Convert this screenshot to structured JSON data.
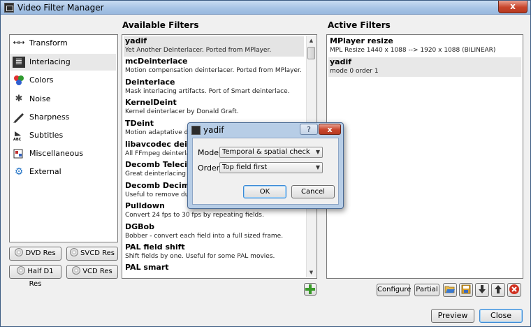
{
  "window": {
    "title": "Video Filter Manager",
    "close_label": "x"
  },
  "categories": {
    "heading": "",
    "items": [
      {
        "label": "Transform",
        "icon": "transform-icon",
        "glyph": "↤↦"
      },
      {
        "label": "Interlacing",
        "icon": "interlacing-icon",
        "glyph": "≣"
      },
      {
        "label": "Colors",
        "icon": "colors-icon",
        "glyph": "●"
      },
      {
        "label": "Noise",
        "icon": "noise-icon",
        "glyph": "✱"
      },
      {
        "label": "Sharpness",
        "icon": "sharpness-icon",
        "glyph": "⟋"
      },
      {
        "label": "Subtitles",
        "icon": "subtitles-icon",
        "glyph": "ᴬᴮᶜ"
      },
      {
        "label": "Miscellaneous",
        "icon": "miscellaneous-icon",
        "glyph": "▦"
      },
      {
        "label": "External",
        "icon": "external-icon",
        "glyph": "⚙"
      }
    ],
    "selected_index": 1
  },
  "presets": [
    {
      "label": "DVD Res"
    },
    {
      "label": "SVCD Res"
    },
    {
      "label": "Half D1 Res"
    },
    {
      "label": "VCD Res"
    }
  ],
  "available": {
    "heading": "Available Filters",
    "items": [
      {
        "name": "yadif",
        "desc": "Yet Another DeInterlacer. Ported from MPlayer."
      },
      {
        "name": "mcDeinterlace",
        "desc": "Motion compensation deinterlacer. Ported from MPlayer."
      },
      {
        "name": "Deinterlace",
        "desc": "Mask interlacing artifacts. Port of Smart deinterlace."
      },
      {
        "name": "KernelDeint",
        "desc": "Kernel deinterlacer by Donald Graft."
      },
      {
        "name": "TDeint",
        "desc": "Motion adaptative deinter"
      },
      {
        "name": "libavcodec deinterla",
        "desc": "All FFmpeg deinterlace fil"
      },
      {
        "name": "Decomb Telecide",
        "desc": "Great deinterlacing packa"
      },
      {
        "name": "Decomb Decimate",
        "desc": "Useful to remove dupes le"
      },
      {
        "name": "Pulldown",
        "desc": "Convert 24 fps to 30 fps by repeating fields."
      },
      {
        "name": "DGBob",
        "desc": "Bobber - convert each field into a full sized frame."
      },
      {
        "name": "PAL field shift",
        "desc": "Shift fields by one. Useful for some PAL movies."
      },
      {
        "name": "PAL smart",
        "desc": ""
      }
    ],
    "selected_index": 0,
    "add_label": "+"
  },
  "active": {
    "heading": "Active Filters",
    "items": [
      {
        "name": "MPlayer resize",
        "desc": "MPL Resize 1440 x 1088 --> 1920 x 1088 (BILINEAR)"
      },
      {
        "name": "yadif",
        "desc": "mode 0 order 1"
      }
    ],
    "selected_index": 1,
    "configure_label": "Configure",
    "partial_label": "Partial"
  },
  "footer": {
    "preview_label": "Preview",
    "close_label": "Close"
  },
  "dialog": {
    "title": "yadif",
    "help_label": "?",
    "close_label": "x",
    "mode_label": "Mode:",
    "mode_value": "Temporal & spatial check",
    "order_label": "Order:",
    "order_value": "Top field first",
    "ok_label": "OK",
    "cancel_label": "Cancel"
  },
  "colors": {
    "accent": "#3399ff",
    "title_bar": "#a8c4e6",
    "close_red": "#c8452c",
    "add_green": "#3a9a2a"
  }
}
